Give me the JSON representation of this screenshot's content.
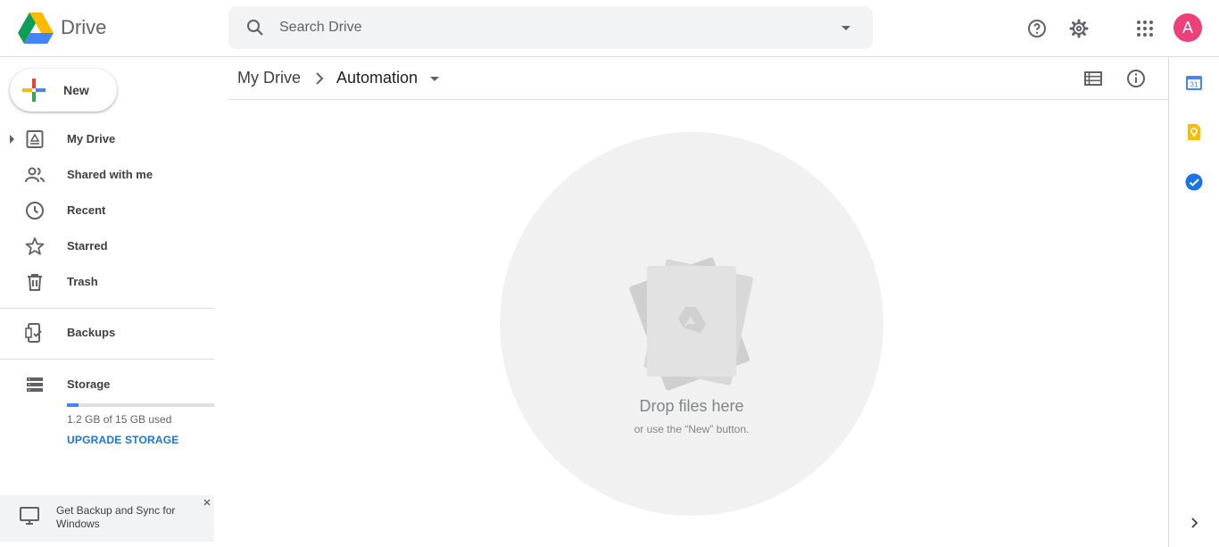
{
  "header": {
    "brand": "Drive",
    "search_placeholder": "Search Drive",
    "avatar_initial": "A",
    "icons": [
      "drive-logo-icon",
      "search-icon",
      "search-options-icon",
      "help-icon",
      "settings-icon",
      "apps-grid-icon"
    ]
  },
  "sidebar": {
    "new_label": "New",
    "items": [
      {
        "label": "My Drive",
        "icon": "my-drive-icon"
      },
      {
        "label": "Shared with me",
        "icon": "shared-icon"
      },
      {
        "label": "Recent",
        "icon": "clock-icon"
      },
      {
        "label": "Starred",
        "icon": "star-icon"
      },
      {
        "label": "Trash",
        "icon": "trash-icon"
      },
      {
        "label": "Backups",
        "icon": "backups-icon"
      },
      {
        "label": "Storage",
        "icon": "storage-icon"
      }
    ],
    "storage": {
      "used_text": "1.2 GB of 15 GB used",
      "used_fraction": 0.08,
      "upgrade_label": "UPGRADE STORAGE"
    },
    "promo": {
      "text": "Get Backup and Sync for Windows",
      "close": "×"
    }
  },
  "main": {
    "breadcrumb": {
      "root": "My Drive",
      "current": "Automation"
    },
    "empty_state": {
      "title": "Drop files here",
      "subtitle": "or use the “New” button."
    }
  },
  "side_panel": {
    "calendar_day": "31",
    "apps": [
      "calendar-icon",
      "keep-icon",
      "tasks-icon"
    ]
  },
  "colors": {
    "accent": "#1a73e8",
    "avatar": "#ec407a",
    "storage_fill": "#4285f4"
  }
}
